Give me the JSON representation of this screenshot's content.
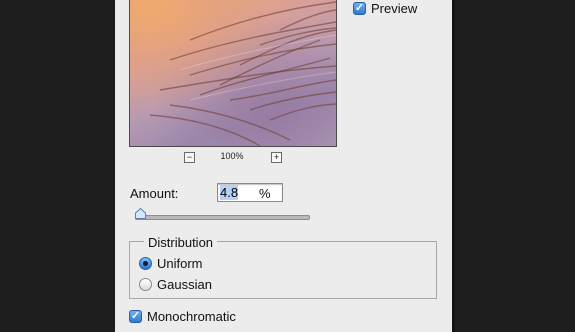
{
  "preview": {
    "checked": true,
    "label": "Preview"
  },
  "zoom": {
    "minus": "−",
    "level": "100%",
    "plus": "+"
  },
  "amount": {
    "label": "Amount:",
    "value": "4.8",
    "unit": "%"
  },
  "distribution": {
    "title": "Distribution",
    "options": [
      {
        "label": "Uniform",
        "selected": true
      },
      {
        "label": "Gaussian",
        "selected": false
      }
    ]
  },
  "monochromatic": {
    "checked": true,
    "label": "Monochromatic"
  },
  "colors": {
    "accent": "#2f79d4",
    "dialog_bg": "#ececec",
    "backdrop": "#1e1e1e"
  },
  "icons": {
    "checkmark": "check-icon"
  }
}
